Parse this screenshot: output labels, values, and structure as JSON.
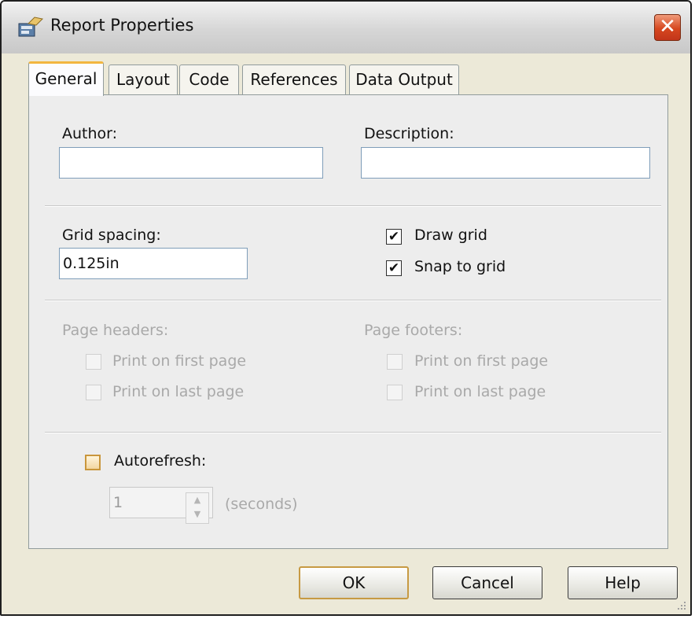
{
  "window": {
    "title": "Report Properties",
    "close_glyph": "✕"
  },
  "tabs": [
    {
      "label": "General",
      "active": true
    },
    {
      "label": "Layout",
      "active": false
    },
    {
      "label": "Code",
      "active": false
    },
    {
      "label": "References",
      "active": false
    },
    {
      "label": "Data Output",
      "active": false
    }
  ],
  "general": {
    "author_label": "Author:",
    "author_value": "",
    "description_label": "Description:",
    "description_value": "",
    "grid_spacing_label": "Grid spacing:",
    "grid_spacing_value": "0.125in",
    "draw_grid_label": "Draw grid",
    "draw_grid_checked": true,
    "snap_to_grid_label": "Snap to grid",
    "snap_to_grid_checked": true,
    "page_headers_label": "Page headers:",
    "page_footers_label": "Page footers:",
    "print_first_label": "Print on first page",
    "print_last_label": "Print on last page",
    "autorefresh_label": "Autorefresh:",
    "autorefresh_checked": false,
    "autorefresh_value": "1",
    "seconds_label": "(seconds)"
  },
  "buttons": {
    "ok": "OK",
    "cancel": "Cancel",
    "help": "Help"
  },
  "colors": {
    "active_tab_accent": "#f2b63f",
    "close_button": "#d6471f",
    "default_button_border": "#c79a43"
  },
  "icons": {
    "title": "app-icon",
    "close": "close-icon",
    "check": "checkmark-icon",
    "spin_up": "chevron-up-icon",
    "spin_down": "chevron-down-icon"
  }
}
